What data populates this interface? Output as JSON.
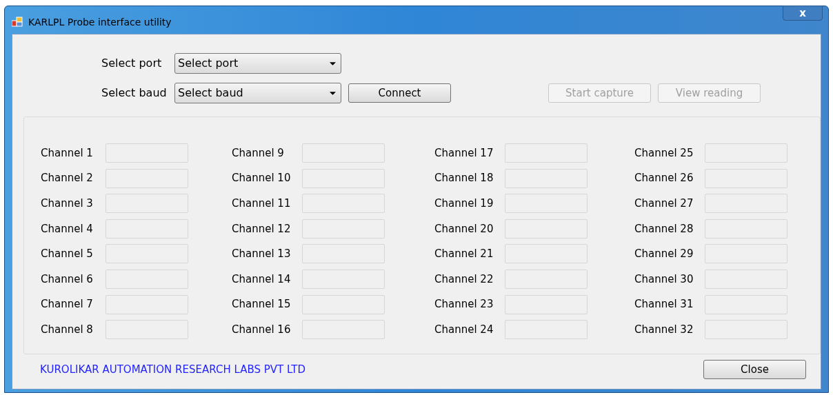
{
  "window": {
    "title": "KARLPL Probe interface utility",
    "close_glyph": "x"
  },
  "port": {
    "label": "Select port",
    "value": "Select port"
  },
  "baud": {
    "label": "Select baud",
    "value": "Select baud"
  },
  "buttons": [
    {
      "label": "Connect",
      "disabled": false
    },
    {
      "label": "Start capture",
      "disabled": true
    },
    {
      "label": "View reading",
      "disabled": true
    }
  ],
  "channels": [
    {
      "label": "Channel 1"
    },
    {
      "label": "Channel 2"
    },
    {
      "label": "Channel 3"
    },
    {
      "label": "Channel 4"
    },
    {
      "label": "Channel 5"
    },
    {
      "label": "Channel 6"
    },
    {
      "label": "Channel 7"
    },
    {
      "label": "Channel 8"
    },
    {
      "label": "Channel 9"
    },
    {
      "label": "Channel 10"
    },
    {
      "label": "Channel 11"
    },
    {
      "label": "Channel 12"
    },
    {
      "label": "Channel 13"
    },
    {
      "label": "Channel 14"
    },
    {
      "label": "Channel 15"
    },
    {
      "label": "Channel 16"
    },
    {
      "label": "Channel 17"
    },
    {
      "label": "Channel 18"
    },
    {
      "label": "Channel 19"
    },
    {
      "label": "Channel 20"
    },
    {
      "label": "Channel 21"
    },
    {
      "label": "Channel 22"
    },
    {
      "label": "Channel 23"
    },
    {
      "label": "Channel 24"
    },
    {
      "label": "Channel 25"
    },
    {
      "label": "Channel 26"
    },
    {
      "label": "Channel 27"
    },
    {
      "label": "Channel 28"
    },
    {
      "label": "Channel 29"
    },
    {
      "label": "Channel 30"
    },
    {
      "label": "Channel 31"
    },
    {
      "label": "Channel 32"
    }
  ],
  "footer": {
    "company": "KUROLIKAR AUTOMATION RESEARCH LABS PVT LTD",
    "close_button": "Close"
  }
}
